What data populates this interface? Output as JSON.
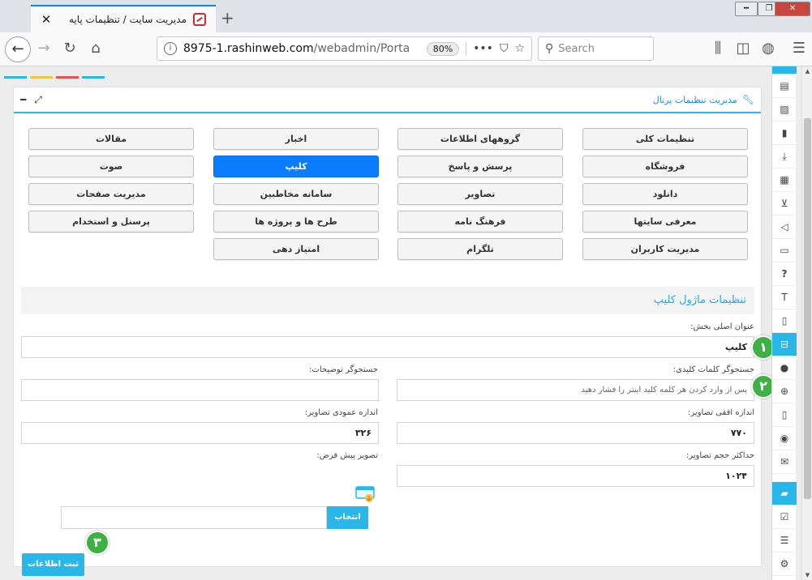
{
  "browser": {
    "tab_title": "مدیریت سایت / تنظیمات پایه",
    "url_domain": "8975-1.rashinweb.com",
    "url_path": "/webadmin/Porta",
    "zoom": "80%",
    "search_placeholder": "Search"
  },
  "colors": {
    "accent": "#29b6e8",
    "active_button": "#0a7cff",
    "step_badge": "#3fb043",
    "top_bars": [
      "#29b6e8",
      "#f5c342",
      "#e9534f",
      "#29b6e8"
    ]
  },
  "panel": {
    "title": "مدیریت تنظیمات پرتال"
  },
  "modules": [
    {
      "label": "تنظیمات کلی",
      "active": false
    },
    {
      "label": "گروههای اطلاعات",
      "active": false
    },
    {
      "label": "اخبار",
      "active": false
    },
    {
      "label": "مقالات",
      "active": false
    },
    {
      "label": "فروشگاه",
      "active": false
    },
    {
      "label": "پرسش و پاسخ",
      "active": false
    },
    {
      "label": "کلیپ",
      "active": true
    },
    {
      "label": "صوت",
      "active": false
    },
    {
      "label": "دانلود",
      "active": false
    },
    {
      "label": "تصاویر",
      "active": false
    },
    {
      "label": "سامانه مخاطبین",
      "active": false
    },
    {
      "label": "مدیریت صفحات",
      "active": false
    },
    {
      "label": "معرفی سایتها",
      "active": false
    },
    {
      "label": "فرهنگ نامه",
      "active": false
    },
    {
      "label": "طرح ها و پروژه ها",
      "active": false
    },
    {
      "label": "پرسنل و استخدام",
      "active": false
    },
    {
      "label": "مدیریت کاربران",
      "active": false
    },
    {
      "label": "تلگرام",
      "active": false
    },
    {
      "label": "امتیاز دهی",
      "active": false
    }
  ],
  "form": {
    "section_title": "تنظیمات ماژول کلیپ",
    "main_title_label": "عنوان اصلی بخش:",
    "main_title_value": "کلیپ",
    "keyword_label": "جستجوگر کلمات کلیدی:",
    "keyword_placeholder": "پس از وارد کردن هر کلمه کلید اینتر را فشار دهید",
    "desc_label": "جستجوگر توضیحات:",
    "desc_value": "",
    "hsize_label": "اندازه افقی تصاویر:",
    "hsize_value": "۷۷۰",
    "vsize_label": "اندازه عمودی تصاویر:",
    "vsize_value": "۳۲۶",
    "maxsize_label": "حداکثر حجم تصاویر:",
    "maxsize_value": "۱۰۲۴",
    "default_image_label": "تصویر پیش فرض:",
    "choose_label": "انتخاب",
    "submit_label": "ثبت اطلاعات"
  },
  "steps": [
    "۱",
    "۲",
    "۳"
  ],
  "dock_icons": [
    "id-card-icon",
    "image-icon",
    "document-icon",
    "download-icon",
    "film-icon",
    "cart-icon",
    "speaker-icon",
    "monitor-icon",
    "question-icon",
    "text-size-icon",
    "file-icon",
    "inbox-icon",
    "user-icon",
    "user-plus-icon",
    "mobile-icon",
    "chat-icon",
    "envelope-icon",
    "folder-open-icon",
    "checkbox-icon",
    "list-icon"
  ]
}
